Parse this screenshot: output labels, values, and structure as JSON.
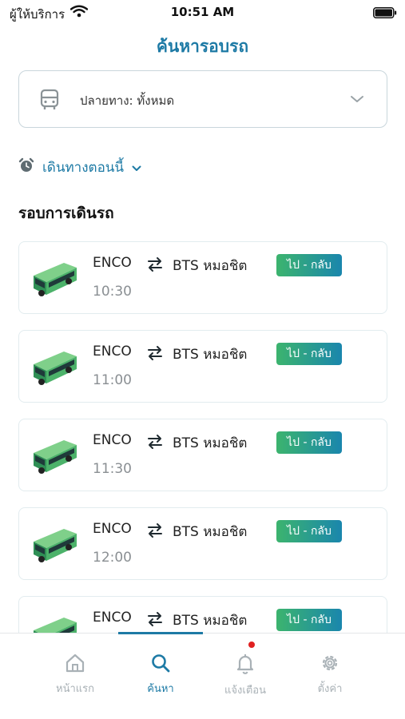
{
  "status": {
    "carrier": "ผู้ให้บริการ",
    "time": "10:51 AM"
  },
  "header": {
    "title": "ค้นหารอบรถ"
  },
  "destination": {
    "label": "ปลายทาง: ทั้งหมด"
  },
  "departure": {
    "label": "เดินทางตอนนี้"
  },
  "section": {
    "title": "รอบการเดินรถ"
  },
  "trips": [
    {
      "from": "ENCO",
      "to": "BTS หมอชิต",
      "badge": "ไป - กลับ",
      "time": "10:30"
    },
    {
      "from": "ENCO",
      "to": "BTS หมอชิต",
      "badge": "ไป - กลับ",
      "time": "11:00"
    },
    {
      "from": "ENCO",
      "to": "BTS หมอชิต",
      "badge": "ไป - กลับ",
      "time": "11:30"
    },
    {
      "from": "ENCO",
      "to": "BTS หมอชิต",
      "badge": "ไป - กลับ",
      "time": "12:00"
    },
    {
      "from": "ENCO",
      "to": "BTS หมอชิต",
      "badge": "ไป - กลับ",
      "time": ""
    }
  ],
  "tabs": [
    {
      "label": "หน้าแรก",
      "icon": "home-icon"
    },
    {
      "label": "ค้นหา",
      "icon": "search-icon"
    },
    {
      "label": "แจ้งเตือน",
      "icon": "bell-icon"
    },
    {
      "label": "ตั้งค่า",
      "icon": "gear-icon"
    }
  ],
  "colors": {
    "accent": "#1d7aa5",
    "badge_start": "#3cb46e",
    "badge_end": "#1a86ad",
    "notification_dot": "#e02020"
  }
}
